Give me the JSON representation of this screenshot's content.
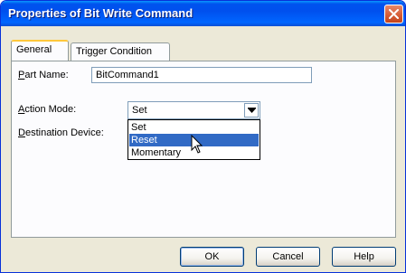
{
  "window": {
    "title": "Properties of Bit Write Command"
  },
  "tabs": [
    {
      "label": "General",
      "active": true
    },
    {
      "label": "Trigger Condition",
      "active": false
    }
  ],
  "form": {
    "part_name": {
      "label_first": "P",
      "label_rest": "art Name:",
      "value": "BitCommand1"
    },
    "action_mode": {
      "label_first": "A",
      "label_rest": "ction Mode:",
      "value": "Set"
    },
    "destination_device": {
      "label_first": "D",
      "label_rest": "estination Device:"
    }
  },
  "dropdown": {
    "options": [
      "Set",
      "Reset",
      "Momentary"
    ],
    "highlighted": "Reset"
  },
  "buttons": {
    "ok": "OK",
    "cancel": "Cancel",
    "help": "Help"
  },
  "colors": {
    "titlebar": "#0053ee",
    "highlight": "#316ac5",
    "close": "#d55a34",
    "tab_accent": "#ffc83c"
  }
}
